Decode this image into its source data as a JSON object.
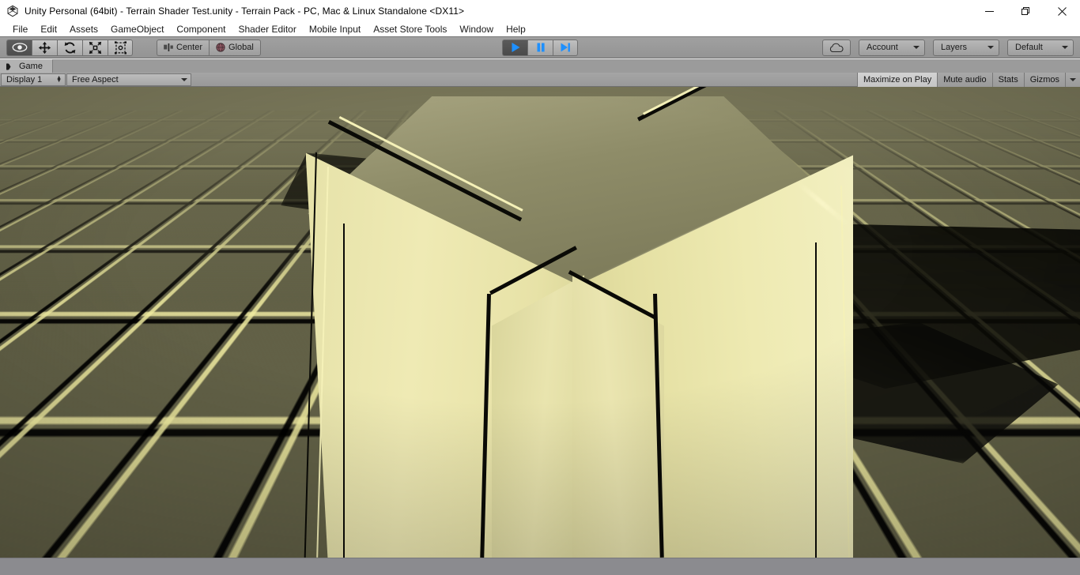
{
  "window": {
    "title": "Unity Personal (64bit) - Terrain Shader Test.unity - Terrain Pack - PC, Mac & Linux Standalone <DX11>",
    "app_icon": "unity-logo-icon",
    "controls": {
      "minimize": "—",
      "maximize": "❐",
      "close": "✕"
    }
  },
  "menubar": {
    "items": [
      {
        "label": "File"
      },
      {
        "label": "Edit"
      },
      {
        "label": "Assets"
      },
      {
        "label": "GameObject"
      },
      {
        "label": "Component"
      },
      {
        "label": "Shader Editor"
      },
      {
        "label": "Mobile Input"
      },
      {
        "label": "Asset Store Tools"
      },
      {
        "label": "Window"
      },
      {
        "label": "Help"
      }
    ]
  },
  "toolbar": {
    "tools": [
      {
        "name": "hand-tool",
        "icon": "hand-eye-icon",
        "active": true
      },
      {
        "name": "move-tool",
        "icon": "move-arrows-icon",
        "active": false
      },
      {
        "name": "rotate-tool",
        "icon": "rotate-arrows-icon",
        "active": false
      },
      {
        "name": "scale-tool",
        "icon": "scale-arrows-icon",
        "active": false
      },
      {
        "name": "rect-tool",
        "icon": "rect-transform-icon",
        "active": false
      }
    ],
    "pivot_mode": "Center",
    "pivot_rotation": "Global",
    "playback": {
      "play": "play-icon",
      "pause": "pause-icon",
      "step": "step-icon",
      "playing": true
    },
    "cloud_label": "cloud-icon",
    "account_label": "Account",
    "layers_label": "Layers",
    "layout_label": "Default"
  },
  "tabs": [
    {
      "label": "Game",
      "icon": "game-controller-icon",
      "selected": true
    }
  ],
  "game_toolbar": {
    "display": "Display 1",
    "aspect": "Free Aspect",
    "maximize_on_play": "Maximize on Play",
    "mute_audio": "Mute audio",
    "stats": "Stats",
    "gizmos": "Gizmos"
  },
  "viewport": {
    "scene_name": "Terrain Shader Test",
    "colors": {
      "sky": "#74725a",
      "ground": "#6b694c",
      "tile_highlight": "#f0ecac",
      "tile_shadow": "#0a0a06",
      "pillar_light": "#efeab4",
      "pillar_top": "#8e8c68"
    }
  },
  "statusbar": {
    "message": ""
  }
}
